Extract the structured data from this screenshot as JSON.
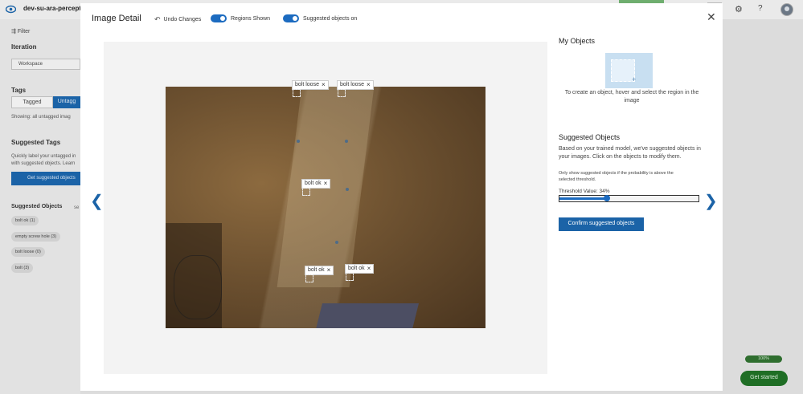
{
  "app": {
    "project_name": "dev-su-ara-percept-sc",
    "settings_icon": "gear-icon",
    "help_label": "?",
    "progress_label": "100%",
    "get_started_label": "Get started"
  },
  "sidebar": {
    "filter_label": "Filter",
    "iteration_heading": "Iteration",
    "iteration_value": "Workspace",
    "tags_heading": "Tags",
    "tab_tagged": "Tagged",
    "tab_untagged": "Untagg",
    "showing_text": "Showing: all untagged imag",
    "suggested_tags_heading": "Suggested Tags",
    "suggested_tags_desc_1": "Quickly label your untagged in",
    "suggested_tags_desc_2": "with suggested objects. Learn",
    "get_suggested_button": "Get suggested objects",
    "suggested_objects_heading": "Suggested Objects",
    "select_label": "se",
    "object_pills": [
      "bolt ok  (1)",
      "empty screw hole  (3)",
      "bolt loose  (0)",
      "bolt  (3)"
    ]
  },
  "dialog": {
    "title": "Image Detail",
    "undo_label": "Undo Changes",
    "regions_toggle_label": "Regions Shown",
    "suggested_toggle_label": "Suggested objects on",
    "close_icon": "close-icon",
    "regions": [
      {
        "label": "bolt loose"
      },
      {
        "label": "bolt loose"
      },
      {
        "label": "bolt ok"
      },
      {
        "label": "bolt ok"
      },
      {
        "label": "bolt ok"
      }
    ],
    "right_panel": {
      "my_objects_heading": "My Objects",
      "my_objects_hint_1": "To create an object, hover and select the region in the",
      "my_objects_hint_2": "image",
      "suggested_heading": "Suggested Objects",
      "suggested_desc_1": "Based on your trained model, we've suggested objects in",
      "suggested_desc_2": "your images. Click on the objects to modify them.",
      "threshold_note_1": "Only show suggested objects if the probability is above the",
      "threshold_note_2": "selected threshold.",
      "threshold_label": "Threshold Value: 34%",
      "threshold_value": 0.34,
      "confirm_button": "Confirm suggested objects"
    }
  },
  "colors": {
    "accent": "#1c6bc0",
    "primary_button": "#1b63a7",
    "get_started": "#1f6e25"
  }
}
